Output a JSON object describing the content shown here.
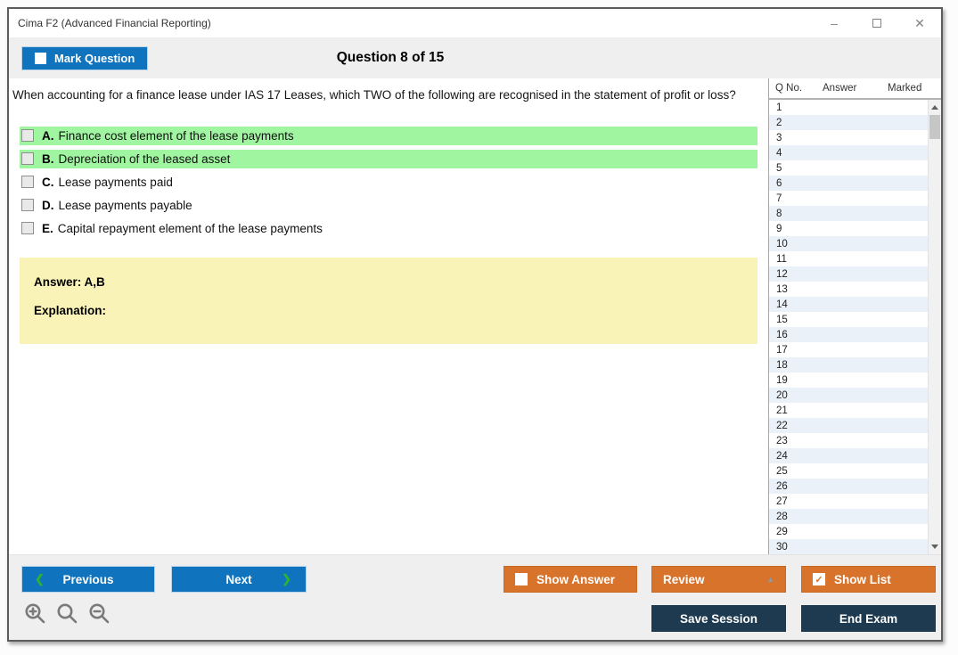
{
  "window": {
    "title": "Cima F2 (Advanced Financial Reporting)",
    "controls": {
      "minimize_glyph": "–",
      "close_glyph": "✕"
    }
  },
  "header": {
    "mark_question_label": "Mark Question",
    "mark_question_checked": false,
    "question_counter": "Question 8 of 15"
  },
  "question": {
    "text": "When accounting for a finance lease under IAS 17 Leases, which TWO of the following are recognised in the statement of profit or loss?"
  },
  "options": [
    {
      "letter": "A.",
      "text": "Finance cost element of the lease payments",
      "highlighted": true,
      "checked": false
    },
    {
      "letter": "B.",
      "text": "Depreciation of the leased asset",
      "highlighted": true,
      "checked": false
    },
    {
      "letter": "C.",
      "text": "Lease payments paid",
      "highlighted": false,
      "checked": false
    },
    {
      "letter": "D.",
      "text": "Lease payments payable",
      "highlighted": false,
      "checked": false
    },
    {
      "letter": "E.",
      "text": "Capital repayment element of the lease payments",
      "highlighted": false,
      "checked": false
    }
  ],
  "answer_panel": {
    "answer_label": "Answer: A,B",
    "explanation_label": "Explanation:"
  },
  "sidebar": {
    "columns": [
      "Q No.",
      "Answer",
      "Marked"
    ],
    "rows": [
      [
        "1",
        "",
        ""
      ],
      [
        "2",
        "",
        ""
      ],
      [
        "3",
        "",
        ""
      ],
      [
        "4",
        "",
        ""
      ],
      [
        "5",
        "",
        ""
      ],
      [
        "6",
        "",
        ""
      ],
      [
        "7",
        "",
        ""
      ],
      [
        "8",
        "",
        ""
      ],
      [
        "9",
        "",
        ""
      ],
      [
        "10",
        "",
        ""
      ],
      [
        "11",
        "",
        ""
      ],
      [
        "12",
        "",
        ""
      ],
      [
        "13",
        "",
        ""
      ],
      [
        "14",
        "",
        ""
      ],
      [
        "15",
        "",
        ""
      ],
      [
        "16",
        "",
        ""
      ],
      [
        "17",
        "",
        ""
      ],
      [
        "18",
        "",
        ""
      ],
      [
        "19",
        "",
        ""
      ],
      [
        "20",
        "",
        ""
      ],
      [
        "21",
        "",
        ""
      ],
      [
        "22",
        "",
        ""
      ],
      [
        "23",
        "",
        ""
      ],
      [
        "24",
        "",
        ""
      ],
      [
        "25",
        "",
        ""
      ],
      [
        "26",
        "",
        ""
      ],
      [
        "27",
        "",
        ""
      ],
      [
        "28",
        "",
        ""
      ],
      [
        "29",
        "",
        ""
      ],
      [
        "30",
        "",
        ""
      ]
    ]
  },
  "footer": {
    "previous_label": "Previous",
    "next_label": "Next",
    "show_answer_label": "Show Answer",
    "show_answer_checked": false,
    "review_label": "Review",
    "show_list_label": "Show List",
    "show_list_checked": true,
    "save_session_label": "Save Session",
    "end_exam_label": "End Exam"
  },
  "icons": {
    "prev_chevron": "❮",
    "next_chevron": "❯",
    "dropdown_glyph": "▲",
    "check_glyph": "✓"
  },
  "colors": {
    "accent_blue": "#1073bd",
    "accent_orange": "#d8732b",
    "navy": "#1d3a50",
    "highlight_green": "#a0f5a0",
    "answer_yellow": "#faf3b8",
    "row_alt_blue": "#eaf1f8",
    "chevron_green": "#2eb135"
  }
}
